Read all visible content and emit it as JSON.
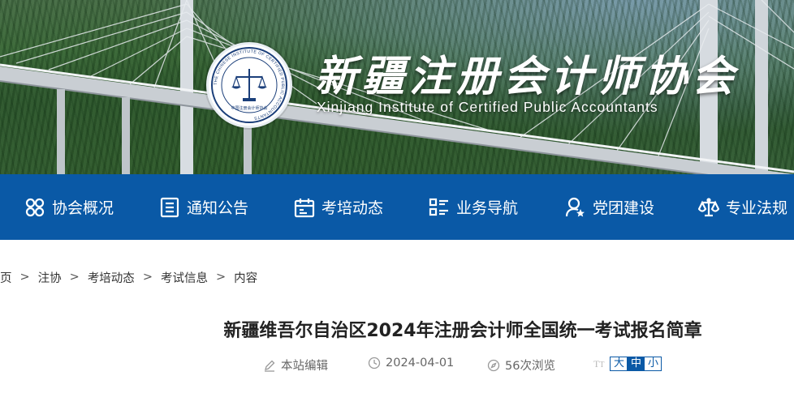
{
  "site": {
    "title_cn": "新疆注册会计师协会",
    "title_en": "Xinjiang Institute of Certified Public Accountants",
    "logo_ring_text": "THE CHINESE INSTITUTE OF CERTIFIED PUBLIC ACCOUNTANTS",
    "logo_inner_text": "中国注册会计师协会"
  },
  "nav": {
    "items": [
      {
        "label": "协会概况",
        "icon": "grid-flower-icon"
      },
      {
        "label": "通知公告",
        "icon": "document-list-icon"
      },
      {
        "label": "考培动态",
        "icon": "calendar-icon"
      },
      {
        "label": "业务导航",
        "icon": "list-navigation-icon"
      },
      {
        "label": "党团建设",
        "icon": "user-star-icon"
      },
      {
        "label": "专业法规",
        "icon": "scales-icon"
      }
    ]
  },
  "breadcrumb": [
    "页",
    "注协",
    "考培动态",
    "考试信息",
    "内容"
  ],
  "breadcrumb_separator": ">",
  "article": {
    "title": "新疆维吾尔自治区2024年注册会计师全国统一考试报名简章",
    "author": "本站编辑",
    "date": "2024-04-01",
    "views": "56次浏览",
    "font_sizes": [
      "大",
      "中",
      "小"
    ],
    "font_size_selected": "中",
    "font_size_label_icon": "text-size-icon"
  },
  "colors": {
    "nav_bg": "#0a59a6",
    "accent": "#0a59a6"
  }
}
